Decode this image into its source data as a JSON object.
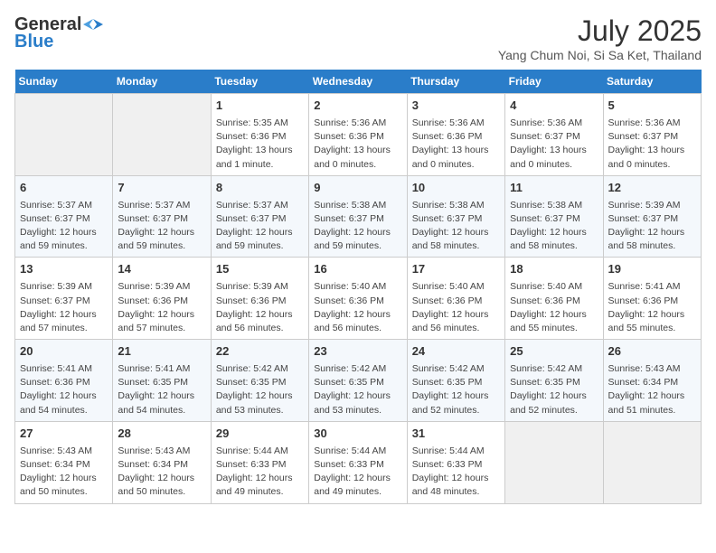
{
  "header": {
    "logo_line1": "General",
    "logo_line2": "Blue",
    "month_year": "July 2025",
    "location": "Yang Chum Noi, Si Sa Ket, Thailand"
  },
  "days_of_week": [
    "Sunday",
    "Monday",
    "Tuesday",
    "Wednesday",
    "Thursday",
    "Friday",
    "Saturday"
  ],
  "weeks": [
    [
      {
        "day": "",
        "info": ""
      },
      {
        "day": "",
        "info": ""
      },
      {
        "day": "1",
        "info": "Sunrise: 5:35 AM\nSunset: 6:36 PM\nDaylight: 13 hours\nand 1 minute."
      },
      {
        "day": "2",
        "info": "Sunrise: 5:36 AM\nSunset: 6:36 PM\nDaylight: 13 hours\nand 0 minutes."
      },
      {
        "day": "3",
        "info": "Sunrise: 5:36 AM\nSunset: 6:36 PM\nDaylight: 13 hours\nand 0 minutes."
      },
      {
        "day": "4",
        "info": "Sunrise: 5:36 AM\nSunset: 6:37 PM\nDaylight: 13 hours\nand 0 minutes."
      },
      {
        "day": "5",
        "info": "Sunrise: 5:36 AM\nSunset: 6:37 PM\nDaylight: 13 hours\nand 0 minutes."
      }
    ],
    [
      {
        "day": "6",
        "info": "Sunrise: 5:37 AM\nSunset: 6:37 PM\nDaylight: 12 hours\nand 59 minutes."
      },
      {
        "day": "7",
        "info": "Sunrise: 5:37 AM\nSunset: 6:37 PM\nDaylight: 12 hours\nand 59 minutes."
      },
      {
        "day": "8",
        "info": "Sunrise: 5:37 AM\nSunset: 6:37 PM\nDaylight: 12 hours\nand 59 minutes."
      },
      {
        "day": "9",
        "info": "Sunrise: 5:38 AM\nSunset: 6:37 PM\nDaylight: 12 hours\nand 59 minutes."
      },
      {
        "day": "10",
        "info": "Sunrise: 5:38 AM\nSunset: 6:37 PM\nDaylight: 12 hours\nand 58 minutes."
      },
      {
        "day": "11",
        "info": "Sunrise: 5:38 AM\nSunset: 6:37 PM\nDaylight: 12 hours\nand 58 minutes."
      },
      {
        "day": "12",
        "info": "Sunrise: 5:39 AM\nSunset: 6:37 PM\nDaylight: 12 hours\nand 58 minutes."
      }
    ],
    [
      {
        "day": "13",
        "info": "Sunrise: 5:39 AM\nSunset: 6:37 PM\nDaylight: 12 hours\nand 57 minutes."
      },
      {
        "day": "14",
        "info": "Sunrise: 5:39 AM\nSunset: 6:36 PM\nDaylight: 12 hours\nand 57 minutes."
      },
      {
        "day": "15",
        "info": "Sunrise: 5:39 AM\nSunset: 6:36 PM\nDaylight: 12 hours\nand 56 minutes."
      },
      {
        "day": "16",
        "info": "Sunrise: 5:40 AM\nSunset: 6:36 PM\nDaylight: 12 hours\nand 56 minutes."
      },
      {
        "day": "17",
        "info": "Sunrise: 5:40 AM\nSunset: 6:36 PM\nDaylight: 12 hours\nand 56 minutes."
      },
      {
        "day": "18",
        "info": "Sunrise: 5:40 AM\nSunset: 6:36 PM\nDaylight: 12 hours\nand 55 minutes."
      },
      {
        "day": "19",
        "info": "Sunrise: 5:41 AM\nSunset: 6:36 PM\nDaylight: 12 hours\nand 55 minutes."
      }
    ],
    [
      {
        "day": "20",
        "info": "Sunrise: 5:41 AM\nSunset: 6:36 PM\nDaylight: 12 hours\nand 54 minutes."
      },
      {
        "day": "21",
        "info": "Sunrise: 5:41 AM\nSunset: 6:35 PM\nDaylight: 12 hours\nand 54 minutes."
      },
      {
        "day": "22",
        "info": "Sunrise: 5:42 AM\nSunset: 6:35 PM\nDaylight: 12 hours\nand 53 minutes."
      },
      {
        "day": "23",
        "info": "Sunrise: 5:42 AM\nSunset: 6:35 PM\nDaylight: 12 hours\nand 53 minutes."
      },
      {
        "day": "24",
        "info": "Sunrise: 5:42 AM\nSunset: 6:35 PM\nDaylight: 12 hours\nand 52 minutes."
      },
      {
        "day": "25",
        "info": "Sunrise: 5:42 AM\nSunset: 6:35 PM\nDaylight: 12 hours\nand 52 minutes."
      },
      {
        "day": "26",
        "info": "Sunrise: 5:43 AM\nSunset: 6:34 PM\nDaylight: 12 hours\nand 51 minutes."
      }
    ],
    [
      {
        "day": "27",
        "info": "Sunrise: 5:43 AM\nSunset: 6:34 PM\nDaylight: 12 hours\nand 50 minutes."
      },
      {
        "day": "28",
        "info": "Sunrise: 5:43 AM\nSunset: 6:34 PM\nDaylight: 12 hours\nand 50 minutes."
      },
      {
        "day": "29",
        "info": "Sunrise: 5:44 AM\nSunset: 6:33 PM\nDaylight: 12 hours\nand 49 minutes."
      },
      {
        "day": "30",
        "info": "Sunrise: 5:44 AM\nSunset: 6:33 PM\nDaylight: 12 hours\nand 49 minutes."
      },
      {
        "day": "31",
        "info": "Sunrise: 5:44 AM\nSunset: 6:33 PM\nDaylight: 12 hours\nand 48 minutes."
      },
      {
        "day": "",
        "info": ""
      },
      {
        "day": "",
        "info": ""
      }
    ]
  ]
}
